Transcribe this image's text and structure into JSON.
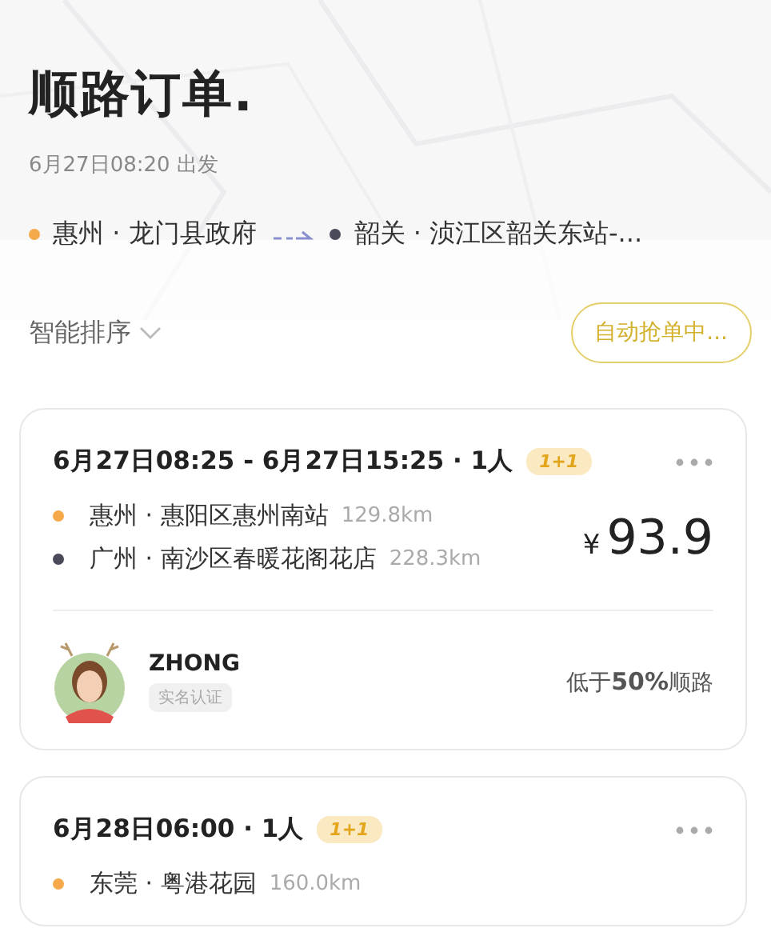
{
  "header": {
    "title": "顺路订单.",
    "departure": "6月27日08:20 出发",
    "origin": "惠州 · 龙门县政府",
    "destination": "韶关 · 浈江区韶关东站-..."
  },
  "sort": {
    "label": "智能排序"
  },
  "auto_button": {
    "label": "自动抢单中..."
  },
  "orders": [
    {
      "time": "6月27日08:25 - 6月27日15:25 · 1人",
      "badge": "1+1",
      "stops": [
        {
          "place": "惠州 · 惠阳区惠州南站",
          "distance": "129.8km",
          "color": "#f5a94a"
        },
        {
          "place": "广州 · 南沙区春暖花阁花店",
          "distance": "228.3km",
          "color": "#4a4a5a"
        }
      ],
      "currency": "¥",
      "price": "93.9",
      "user": {
        "name": "ZHONG",
        "verified": "实名认证"
      },
      "note": "低于**50%**顺路"
    },
    {
      "time": "6月28日06:00 · 1人",
      "badge": "1+1",
      "stops": [
        {
          "place": "东莞 · 粤港花园",
          "distance": "160.0km",
          "color": "#f5a94a"
        }
      ]
    }
  ]
}
